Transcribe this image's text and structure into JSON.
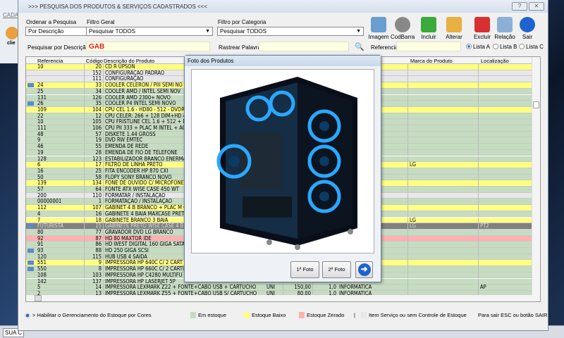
{
  "window": {
    "title": ">>> PESQUISA DOS PRODUTOS & SERVIÇOS CADASTRADOS <<<",
    "help": "?",
    "close": "✕"
  },
  "background_app": {
    "menu": "CADA",
    "status": "SUA C",
    "icon_label": "clie"
  },
  "filters": {
    "order_label": "Ordenar a Pesquisa",
    "order_value": "Por Descrição",
    "general_label": "Filtro Geral",
    "general_value": "Pesquisar TODOS",
    "category_label": "Filtro por Categoria",
    "category_value": "Pesquisar TODOS",
    "desc_label": "Pesquisar por Descrição",
    "desc_value": "GAB",
    "words_label": "Rastrear Palavras",
    "words_value": "",
    "ref_label": "Referencia",
    "ref_value": ""
  },
  "toolbar": [
    {
      "label": "Imagem",
      "icon": "image-icon"
    },
    {
      "label": "CodBarra",
      "icon": "barcode-icon"
    },
    {
      "label": "Incluir",
      "icon": "add-icon"
    },
    {
      "label": "Alterar",
      "icon": "edit-icon"
    },
    {
      "label": "Excluir",
      "icon": "delete-icon"
    },
    {
      "label": "Relação",
      "icon": "print-icon"
    },
    {
      "label": "Sair",
      "icon": "exit-arrow-icon"
    }
  ],
  "lists": {
    "options": [
      "Lista A",
      "Lista B",
      "Lista C"
    ],
    "selected": "Lista A"
  },
  "grid": {
    "columns": [
      "Referencia",
      "Código",
      "Descrição do Produto",
      "Marca do Produto",
      "Localização"
    ],
    "rows": [
      {
        "ref": "10",
        "code": "20",
        "desc": "CD R UPSON",
        "status": "low"
      },
      {
        "ref": "",
        "code": "152",
        "desc": "CONFIGURAÇAO PADRAO",
        "status": "service"
      },
      {
        "ref": "",
        "code": "111",
        "desc": "CONFIGURAÇÃO",
        "status": "service"
      },
      {
        "ref": "24",
        "code": "33",
        "desc": "COOLER   CELERON / PIII  SEMI  NO",
        "status": "low",
        "photo": true
      },
      {
        "ref": "25",
        "code": "34",
        "desc": "COOLER  AMD  /  INTEL  SEMI  NOV",
        "status": "stock"
      },
      {
        "ref": "131",
        "code": "126",
        "desc": "COOLER  AMD  2300+  NOVO",
        "status": "stock"
      },
      {
        "ref": "26",
        "code": "35",
        "desc": "COOLER  P4  INTEL  SEMI  NOVO",
        "status": "stock",
        "photo": true
      },
      {
        "ref": "109",
        "code": "104",
        "desc": "CPU CEL 1.6 - HD80 - 512 - DVDRW -",
        "status": "low"
      },
      {
        "ref": "22",
        "code": "12",
        "desc": "CPU CELER: 266 + 128 DIM+HD 4.3+",
        "status": "stock"
      },
      {
        "ref": "10",
        "code": "105",
        "desc": "CPU FRISTLINE CEL 1.6 + 512 + DVD",
        "status": "stock"
      },
      {
        "ref": "111",
        "code": "106",
        "desc": "CPU PII 333 + PLAC M INTEL + AGP 8",
        "status": "stock"
      },
      {
        "ref": "48",
        "code": "57",
        "desc": "DISKETE  1.44  GROSS",
        "status": "stock"
      },
      {
        "ref": "9",
        "code": "19",
        "desc": "DVD RW EMTEC",
        "status": "stock"
      },
      {
        "ref": "46",
        "code": "55",
        "desc": "EMENDA  DE  REDE",
        "status": "stock"
      },
      {
        "ref": "19",
        "code": "28",
        "desc": "EMENDA  DE FIO  DE  TELEFONE",
        "status": "stock"
      },
      {
        "ref": "128",
        "code": "123",
        "desc": "ESTABILIZADOR  BRANCO  ENERMA",
        "status": "stock"
      },
      {
        "ref": "6",
        "code": "17",
        "desc": "FILTRO  DE  LINHA  PRETO",
        "status": "low",
        "brand": "LG"
      },
      {
        "ref": "16",
        "code": "25",
        "desc": "FITA  ENCODER  HP  870 CXI",
        "status": "stock"
      },
      {
        "ref": "50",
        "code": "58",
        "desc": "FLOPY  SONY  BRANCO  NOVO",
        "status": "stock"
      },
      {
        "ref": "139",
        "code": "134",
        "desc": "FONE  DE  OUVIDO  C/  MICROFONE",
        "status": "low"
      },
      {
        "ref": "57",
        "code": "64",
        "desc": "FONTE  ATX  WISE  CASE  450 WT",
        "status": "stock"
      },
      {
        "ref": "200",
        "code": "110",
        "desc": "FORMATAR  /  INSTALAÇÃO",
        "status": "service"
      },
      {
        "ref": "00000001",
        "code": "1",
        "desc": "FORMATAÇÃO / INSTALAÇÃO",
        "status": "stock"
      },
      {
        "ref": "112",
        "code": "107",
        "desc": "GABINET 4 B BRANCO + PLAC M GFX",
        "status": "low"
      },
      {
        "ref": "4",
        "code": "16",
        "desc": "GABINETE  4  BAIA MAXCASE PRETO",
        "status": "stock"
      },
      {
        "ref": "7",
        "code": "18",
        "desc": "GABINETE  BRANCO  3 BAIA",
        "status": "low",
        "brand": "LG"
      },
      {
        "ref": "FUTURISTA",
        "code": "15",
        "desc": "GABINETE  PRETO  WISE CASE  4  B",
        "status": "selected",
        "brand": "LG",
        "loc": "PT2",
        "photo": true
      },
      {
        "ref": "80",
        "code": "77",
        "desc": "GRAVADOR  DVD  LG  BRANCO",
        "status": "stock"
      },
      {
        "ref": "92",
        "code": "87",
        "desc": "HD  80  MAXTOR  IDE",
        "status": "zero"
      },
      {
        "ref": "91",
        "code": "86",
        "desc": "HD  WEST DIGITAL  160 GIGA  SATA",
        "status": "stock"
      },
      {
        "ref": "93",
        "code": "88",
        "desc": "HD  250 GIGA SCSI",
        "status": "stock",
        "photo": true
      },
      {
        "ref": "120",
        "code": "115",
        "desc": "HUB  USB  4  SAIDA",
        "status": "stock"
      },
      {
        "ref": "551",
        "code": "9",
        "desc": "IMPRESSORA  HP  640C   C/ 2 CART",
        "status": "low",
        "photo": true
      },
      {
        "ref": "550",
        "code": "8",
        "desc": "IMPRESSORA  HP  660C  C/ 2 CARTU",
        "status": "stock",
        "photo": true
      },
      {
        "ref": "108",
        "code": "103",
        "desc": "IMPRESSORA  HP  C4280  MULTIFU",
        "status": "stock"
      },
      {
        "ref": "142",
        "code": "137",
        "desc": "IMPRESSORA  HP  LASERJET  5P",
        "status": "stock"
      },
      {
        "ref": "5",
        "code": "14",
        "desc": "IMPRESSORA  LEXMARK  Z22 + FONTE+CABO USB + CARTUCHO",
        "unit": "UNI",
        "price": "150,00",
        "qty": "1,0",
        "cat": "INFORMATICA",
        "status": "stock",
        "loc": "AP"
      },
      {
        "ref": "2",
        "code": "13",
        "desc": "IMPRESSORA  LEXMARK  Z55 + FONTE+CABO USB  S/ CARTUCHO",
        "unit": "UNI",
        "price": "80,00",
        "qty": "1,0",
        "cat": "INFORMATICA",
        "status": "stock"
      }
    ]
  },
  "status_colors": {
    "stock": "#c5dcc0",
    "low": "#ffff80",
    "zero": "#ffb0b0",
    "service": "#e8e8e8",
    "selected": "#808080"
  },
  "legend": {
    "toggle": "> Habilitar o Gerenciamento do Estoque por Cores",
    "stock": "Em estoque",
    "low": "Estoque Baixo",
    "zero": "Estoque Zerado",
    "sep": "|",
    "service": "Item Serviço ou sem Controle de Estoque",
    "exit_hint": "Para sair ESC ou botão SAIR"
  },
  "photo_dialog": {
    "title": "Foto dos Produtos",
    "btn1": "1ª Foto",
    "btn2": "2ª Foto"
  }
}
